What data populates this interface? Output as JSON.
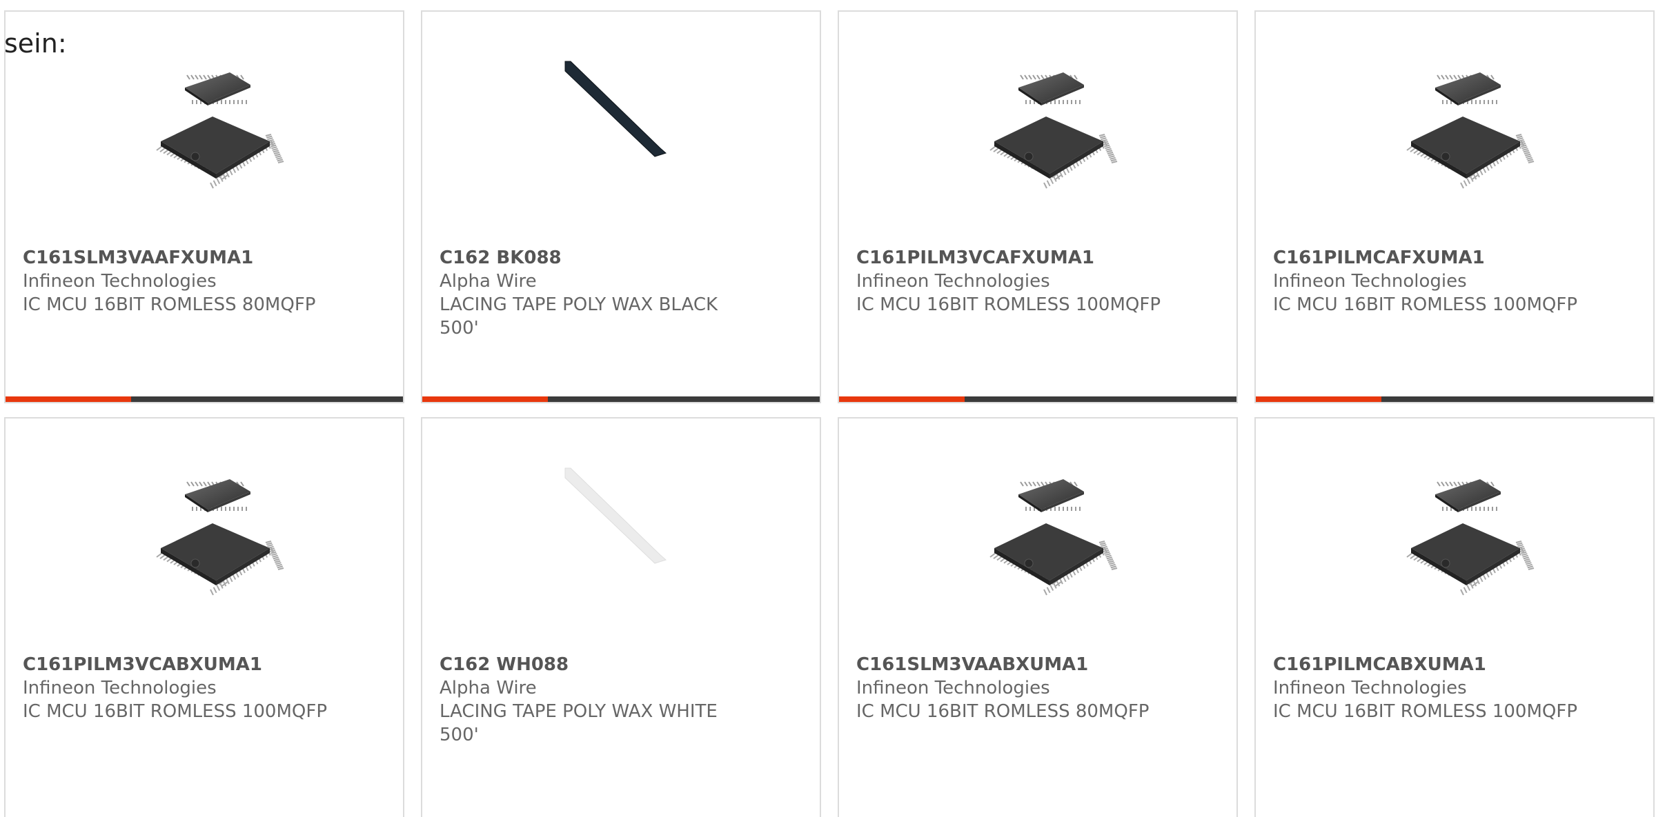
{
  "intro_text": "sein:",
  "accent_color": "#e8380d",
  "bar_color": "#3b3b3b",
  "products": [
    {
      "part_number": "C161SLM3VAAFXUMA1",
      "manufacturer": "Infineon Technologies",
      "description": "IC MCU 16BIT ROMLESS 80MQFP",
      "image": "chip-icon"
    },
    {
      "part_number": "C162 BK088",
      "manufacturer": "Alpha Wire",
      "description": "LACING TAPE POLY WAX BLACK 500'",
      "image": "black-tape-icon"
    },
    {
      "part_number": "C161PILM3VCAFXUMA1",
      "manufacturer": "Infineon Technologies",
      "description": "IC MCU 16BIT ROMLESS 100MQFP",
      "image": "chip-icon"
    },
    {
      "part_number": "C161PILMCAFXUMA1",
      "manufacturer": "Infineon Technologies",
      "description": "IC MCU 16BIT ROMLESS 100MQFP",
      "image": "chip-icon"
    },
    {
      "part_number": "C161PILM3VCABXUMA1",
      "manufacturer": "Infineon Technologies",
      "description": "IC MCU 16BIT ROMLESS 100MQFP",
      "image": "chip-icon"
    },
    {
      "part_number": "C162 WH088",
      "manufacturer": "Alpha Wire",
      "description": "LACING TAPE POLY WAX WHITE 500'",
      "image": "white-tape-icon"
    },
    {
      "part_number": "C161SLM3VAABXUMA1",
      "manufacturer": "Infineon Technologies",
      "description": "IC MCU 16BIT ROMLESS 80MQFP",
      "image": "chip-icon"
    },
    {
      "part_number": "C161PILMCABXUMA1",
      "manufacturer": "Infineon Technologies",
      "description": "IC MCU 16BIT ROMLESS 100MQFP",
      "image": "chip-icon"
    }
  ]
}
